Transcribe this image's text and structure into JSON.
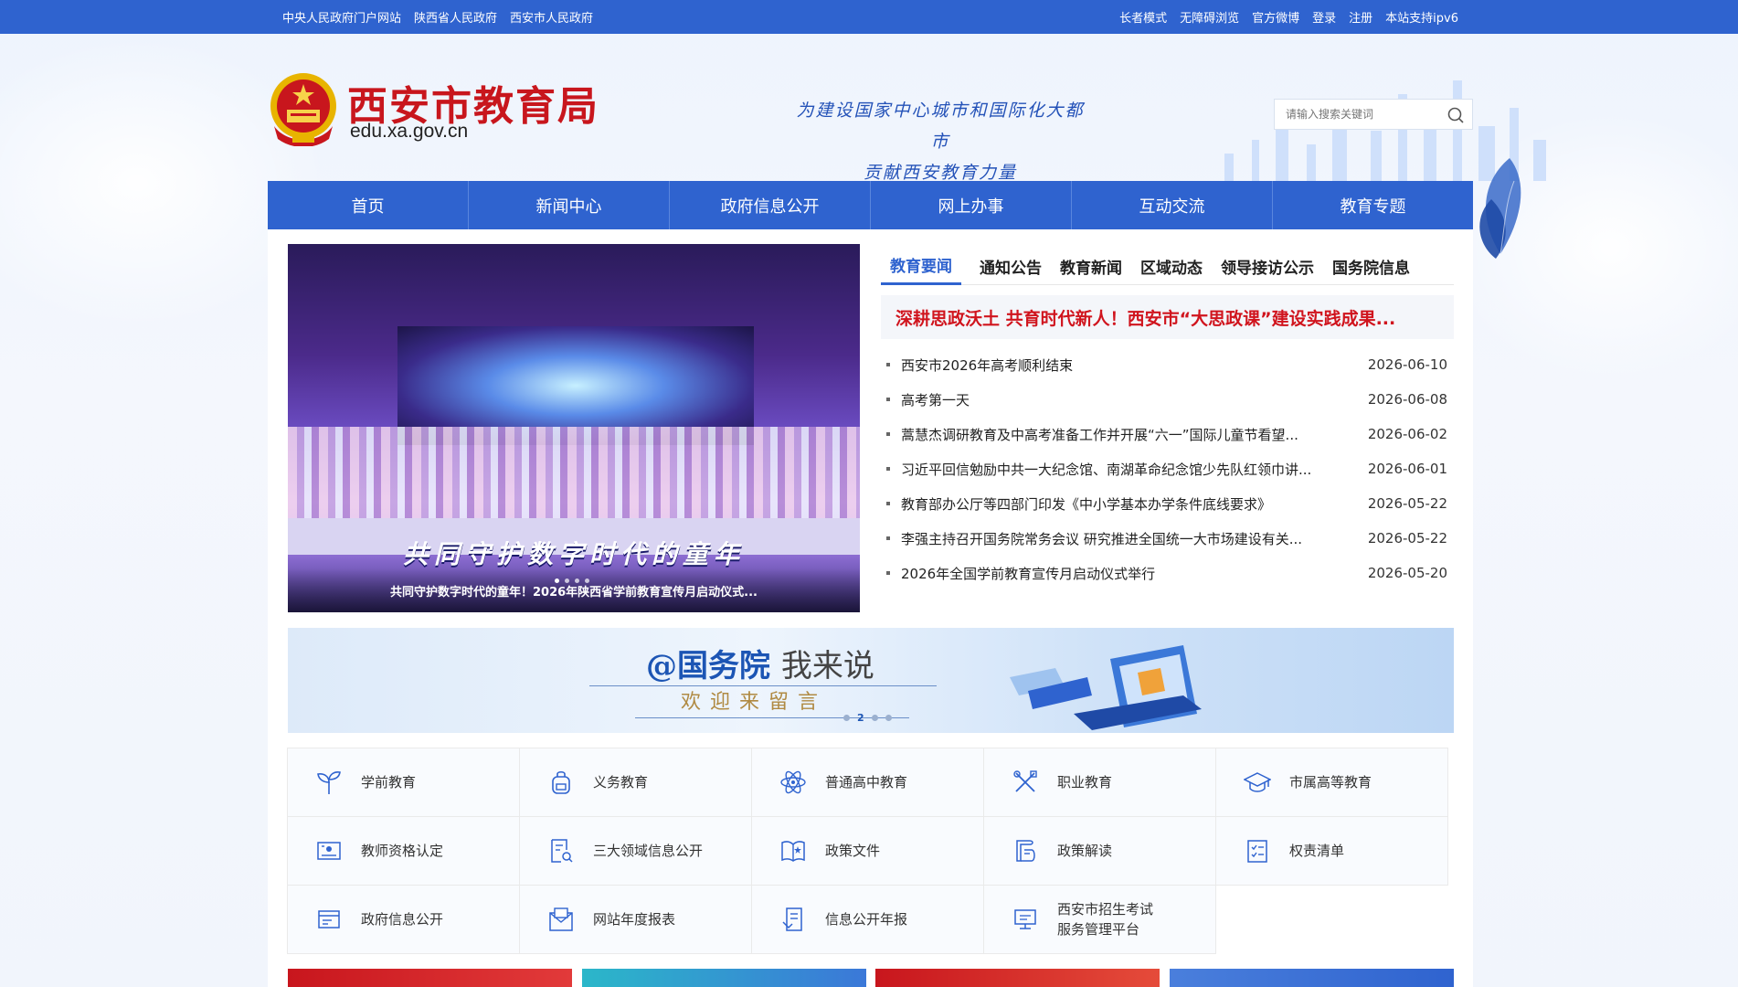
{
  "topbar": {
    "left_links": [
      "中央人民政府门户网站",
      "陕西省人民政府",
      "西安市人民政府"
    ],
    "right_links": [
      "长者模式",
      "无障碍浏览",
      "官方微博",
      "登录",
      "注册",
      "本站支持ipv6"
    ]
  },
  "header": {
    "logo_title": "西安市教育局",
    "logo_domain": "edu.xa.gov.cn",
    "slogan_line1": "为建设国家中心城市和国际化大都市",
    "slogan_line2": "贡献西安教育力量",
    "search_placeholder": "请输入搜索关键词"
  },
  "nav": [
    "首页",
    "新闻中心",
    "政府信息公开",
    "网上办事",
    "互动交流",
    "教育专题"
  ],
  "carousel": {
    "banner_text": "共同守护数字时代的童年",
    "caption": "共同守护数字时代的童年！2026年陕西省学前教育宣传月启动仪式..."
  },
  "news": {
    "tabs": [
      "教育要闻",
      "通知公告",
      "教育新闻",
      "区域动态",
      "领导接访公示",
      "国务院信息"
    ],
    "active_tab": "教育要闻",
    "headline": "深耕思政沃土 共育时代新人！西安市“大思政课”建设实践成果...",
    "items": [
      {
        "title": "西安市2026年高考顺利结束",
        "date": "2026-06-10"
      },
      {
        "title": "高考第一天",
        "date": "2026-06-08"
      },
      {
        "title": "蒿慧杰调研教育及中高考准备工作并开展“六一”国际儿童节看望...",
        "date": "2026-06-02"
      },
      {
        "title": "习近平回信勉励中共一大纪念馆、南湖革命纪念馆少先队红领巾讲...",
        "date": "2026-06-01"
      },
      {
        "title": "教育部办公厅等四部门印发《中小学基本办学条件底线要求》",
        "date": "2026-05-22"
      },
      {
        "title": "李强主持召开国务院常务会议 研究推进全国统一大市场建设有关...",
        "date": "2026-05-22"
      },
      {
        "title": "2026年全国学前教育宣传月启动仪式举行",
        "date": "2026-05-20"
      }
    ]
  },
  "ad": {
    "prefix": "@国务院",
    "suffix": "我来说",
    "subtitle": "欢迎来留言",
    "page_indicator": "2"
  },
  "services": [
    {
      "label": "学前教育",
      "icon": "sprout-icon"
    },
    {
      "label": "义务教育",
      "icon": "backpack-icon"
    },
    {
      "label": "普通高中教育",
      "icon": "atom-icon"
    },
    {
      "label": "职业教育",
      "icon": "tools-icon"
    },
    {
      "label": "市属高等教育",
      "icon": "graduation-cap-icon"
    },
    {
      "label": "教师资格认定",
      "icon": "certificate-icon"
    },
    {
      "label": "三大领域信息公开",
      "icon": "document-search-icon"
    },
    {
      "label": "政策文件",
      "icon": "policy-book-icon"
    },
    {
      "label": "政策解读",
      "icon": "interpretation-icon"
    },
    {
      "label": "权责清单",
      "icon": "checklist-icon"
    },
    {
      "label": "政府信息公开",
      "icon": "folder-icon"
    },
    {
      "label": "网站年度报表",
      "icon": "report-icon"
    },
    {
      "label": "信息公开年报",
      "icon": "annual-report-icon"
    },
    {
      "label": "西安市招生考试服务管理平台",
      "icon": "monitor-icon"
    }
  ],
  "colors": {
    "brand_blue": "#2f63cf",
    "headline_red": "#d0141d",
    "logo_red": "#c8161d"
  }
}
